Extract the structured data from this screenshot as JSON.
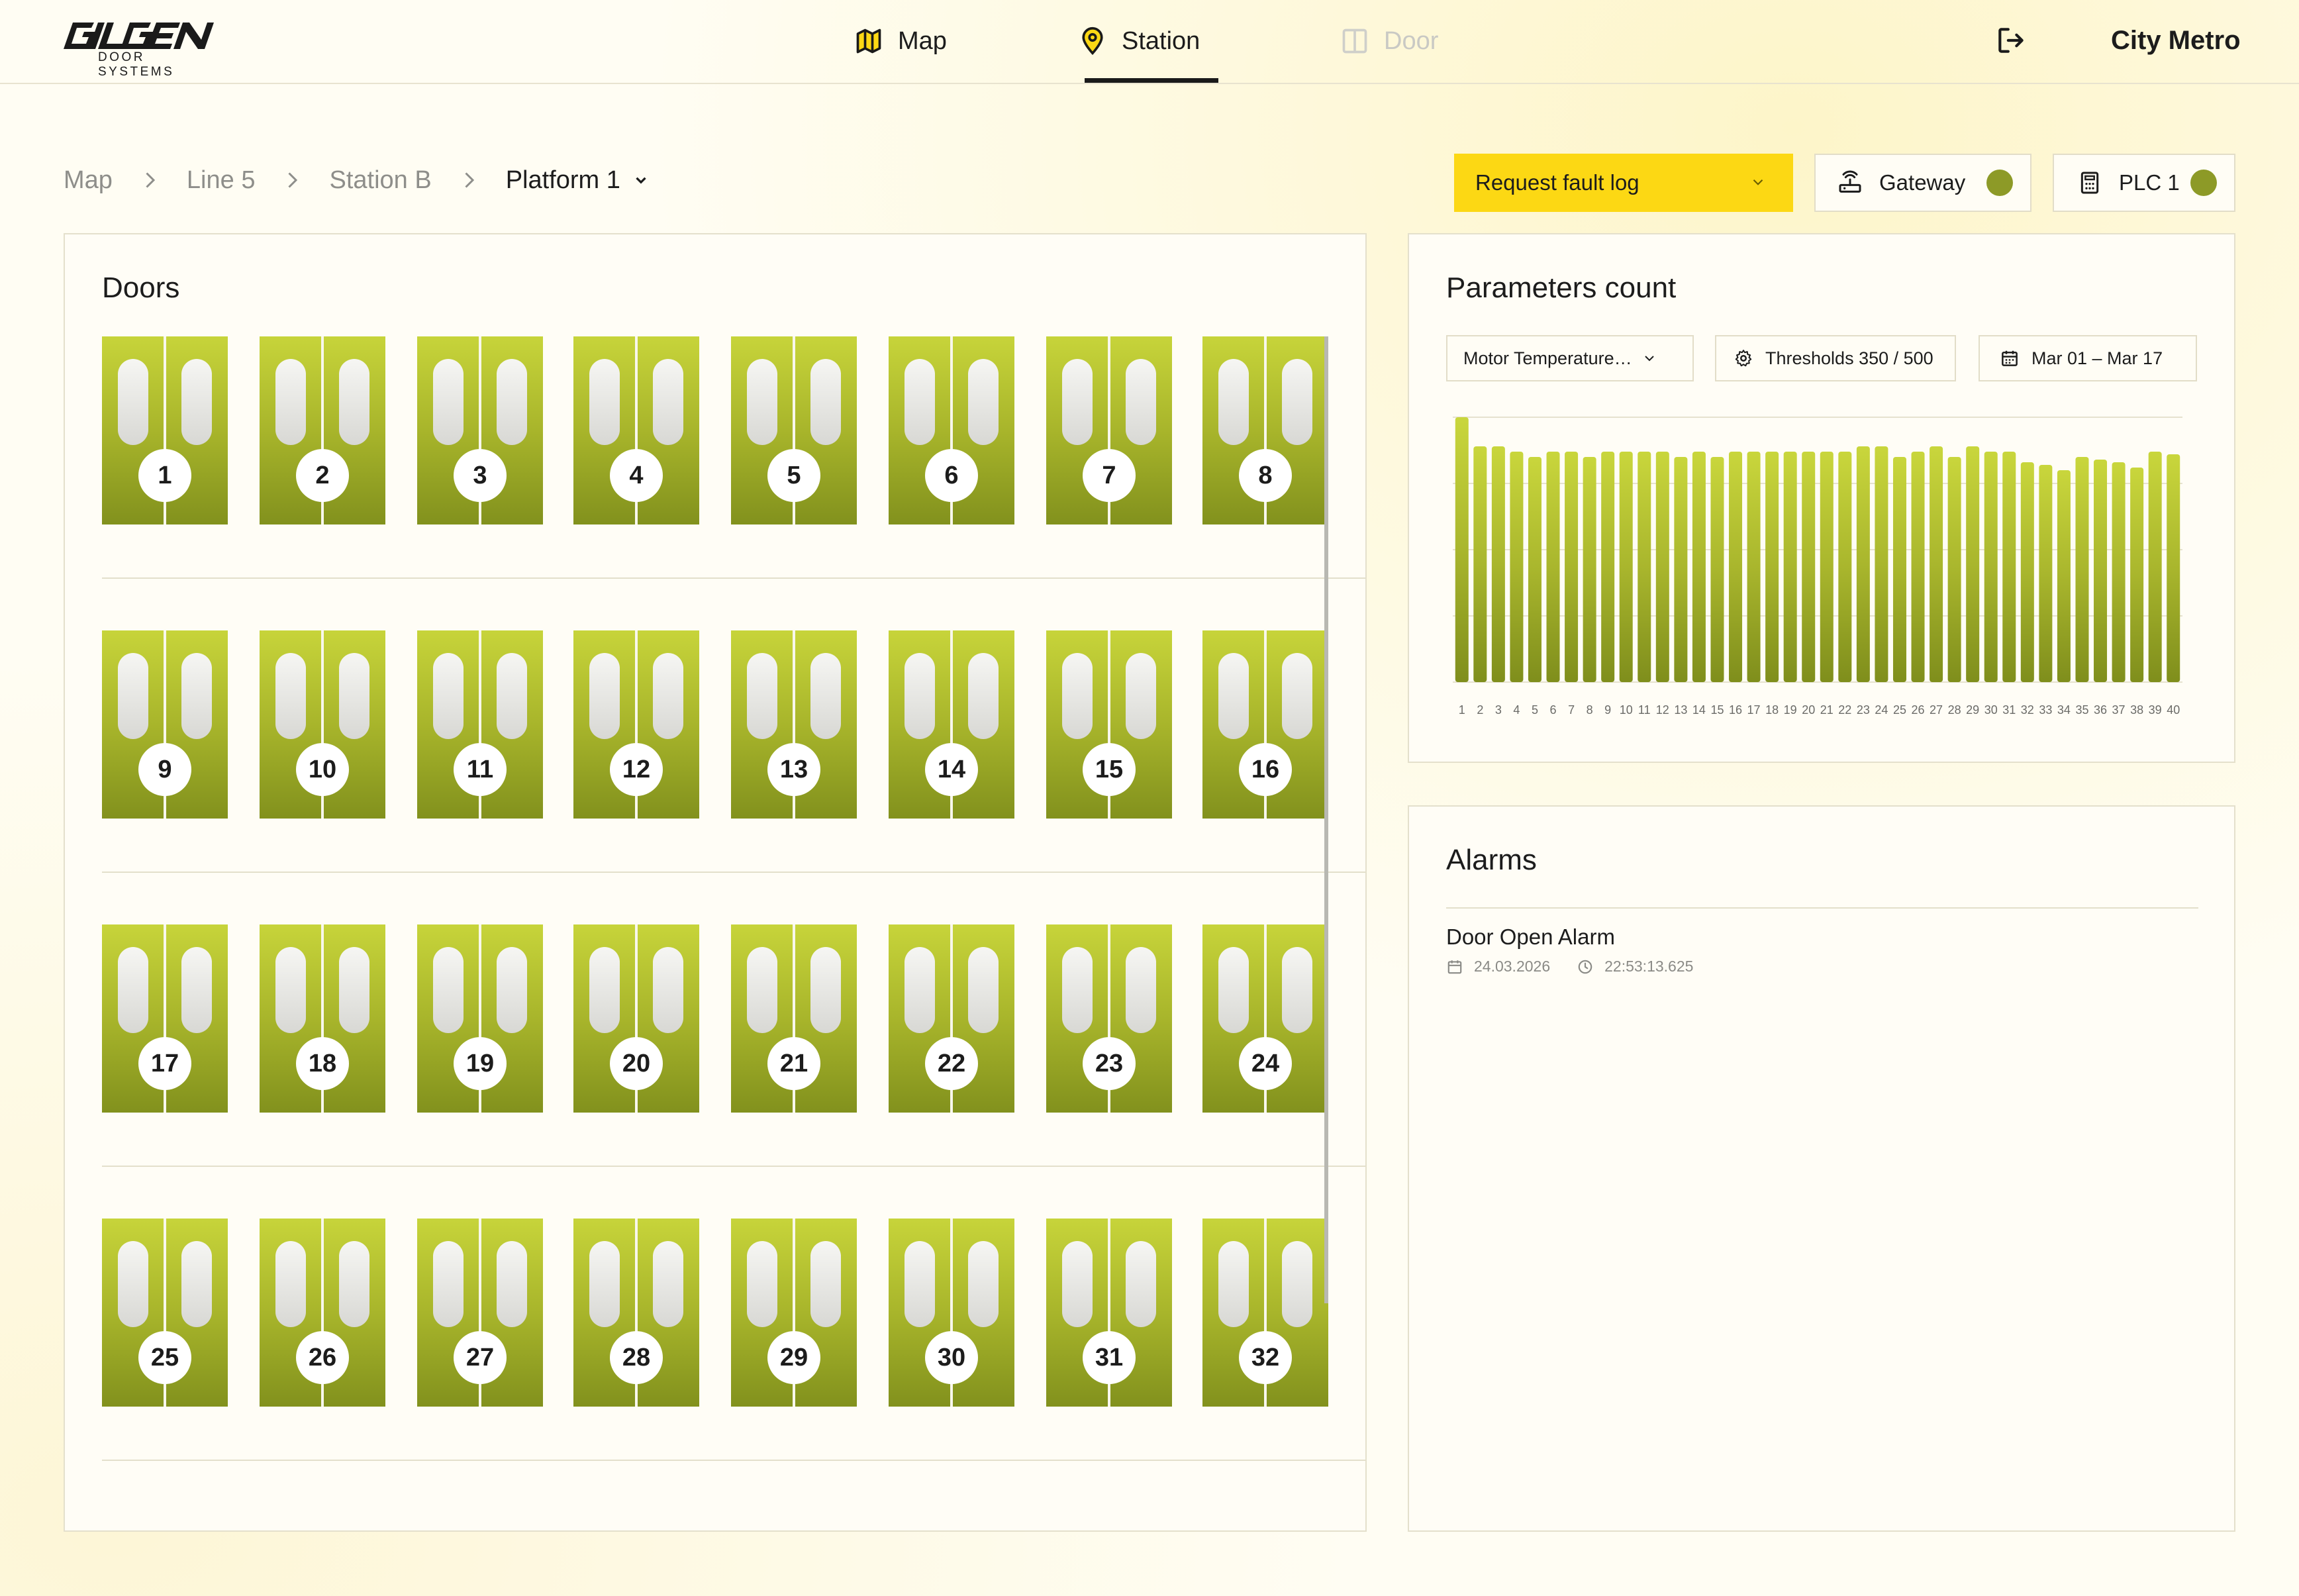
{
  "brand": {
    "name": "GILGEN",
    "sub": "DOOR SYSTEMS"
  },
  "nav": {
    "items": [
      {
        "label": "Map",
        "icon": "map-icon",
        "state": "default"
      },
      {
        "label": "Station",
        "icon": "location-pin-icon",
        "state": "active"
      },
      {
        "label": "Door",
        "icon": "door-icon",
        "state": "disabled"
      }
    ],
    "logout_icon": "logout-icon",
    "customer": "City Metro"
  },
  "breadcrumb": {
    "items": [
      "Map",
      "Line 5",
      "Station B"
    ],
    "current": "Platform 1"
  },
  "actions": {
    "fault_log_label": "Request fault log",
    "gateway": {
      "label": "Gateway",
      "status_color": "#8d9a27"
    },
    "plc": {
      "label": "PLC 1",
      "status_color": "#8d9a27"
    }
  },
  "doors": {
    "title": "Doors",
    "numbers": [
      "1",
      "2",
      "3",
      "4",
      "5",
      "6",
      "7",
      "8",
      "9",
      "10",
      "11",
      "12",
      "13",
      "14",
      "15",
      "16",
      "17",
      "18",
      "19",
      "20",
      "21",
      "22",
      "23",
      "24",
      "25",
      "26",
      "27",
      "28",
      "29",
      "30",
      "31",
      "32"
    ],
    "color": "#a8b52b"
  },
  "parameters": {
    "title": "Parameters count",
    "metric": "Motor Temperature…",
    "thresholds": "Thresholds 350 / 500",
    "date_range": "Mar 01 – Mar 17"
  },
  "chart_data": {
    "type": "bar",
    "categories": [
      "1",
      "2",
      "3",
      "4",
      "5",
      "6",
      "7",
      "8",
      "9",
      "10",
      "11",
      "12",
      "13",
      "14",
      "15",
      "16",
      "17",
      "18",
      "19",
      "20",
      "21",
      "22",
      "23",
      "24",
      "25",
      "26",
      "27",
      "28",
      "29",
      "30",
      "31",
      "32",
      "33",
      "34",
      "35",
      "36",
      "37",
      "38",
      "39",
      "40"
    ],
    "values": [
      100,
      89,
      89,
      87,
      85,
      87,
      87,
      85,
      87,
      87,
      87,
      87,
      85,
      87,
      85,
      87,
      87,
      87,
      87,
      87,
      87,
      87,
      89,
      89,
      85,
      87,
      89,
      85,
      89,
      87,
      87,
      83,
      82,
      80,
      85,
      84,
      83,
      81,
      87,
      86
    ],
    "ylim": [
      0,
      100
    ],
    "grid": true,
    "bar_color": "#a8b52b"
  },
  "alarms": {
    "title": "Alarms",
    "items": [
      {
        "title": "Door Open Alarm",
        "date": "24.03.2026",
        "time": "22:53:13.625"
      }
    ]
  }
}
